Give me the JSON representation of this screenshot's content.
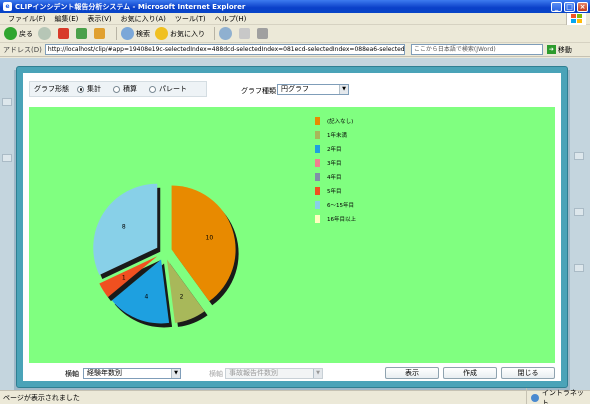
{
  "window": {
    "title": "CLIPインシデント報告分析システム - Microsoft Internet Explorer",
    "minimize": "_",
    "maximize": "□",
    "close": "×"
  },
  "menu": [
    "ファイル(F)",
    "編集(E)",
    "表示(V)",
    "お気に入り(A)",
    "ツール(T)",
    "ヘルプ(H)"
  ],
  "toolbar": {
    "back_label": "戻る",
    "search_label": "検索",
    "favorites_label": "お気に入り"
  },
  "address": {
    "label": "アドレス(D)",
    "url": "http://localhost/clip/#app=19408e19c-selectedIndex=488dcd-selectedIndex=081ecd-selectedIndex=088ea6-selectedIndex=6",
    "search_placeholder": "ここから日本語で検索(JWord)",
    "go_label": "移動"
  },
  "dialog": {
    "form_label": "グラフ形態",
    "radios": [
      {
        "label": "集計",
        "selected": true
      },
      {
        "label": "積算",
        "selected": false
      },
      {
        "label": "パレート",
        "selected": false
      }
    ],
    "type_label": "グラフ種類",
    "type_value": "円グラフ",
    "axis_label": "横軸",
    "axis_value": "経験年数別",
    "filter_label": "横軸",
    "filter_value": "事故報告件数別",
    "buttons": {
      "show": "表示",
      "create": "作成",
      "close": "閉じる"
    }
  },
  "chart_data": {
    "type": "pie",
    "title": "",
    "slices": [
      {
        "label": "(記入なし)",
        "value": 10,
        "color": "#e88a00"
      },
      {
        "label": "1年未満",
        "value": 2,
        "color": "#a8b85a"
      },
      {
        "label": "2年目",
        "value": 4,
        "color": "#1ea0e0"
      },
      {
        "label": "3年目",
        "value": 0,
        "color": "#f08090"
      },
      {
        "label": "4年目",
        "value": 0,
        "color": "#8090a8"
      },
      {
        "label": "5年目",
        "value": 1,
        "color": "#f05020"
      },
      {
        "label": "6～15年目",
        "value": 8,
        "color": "#88d0e8"
      },
      {
        "label": "16年目以上",
        "value": 0,
        "color": "#ffffc0"
      }
    ],
    "legend_position": "right"
  },
  "status": {
    "text": "ページが表示されました",
    "zone": "イントラネット"
  }
}
